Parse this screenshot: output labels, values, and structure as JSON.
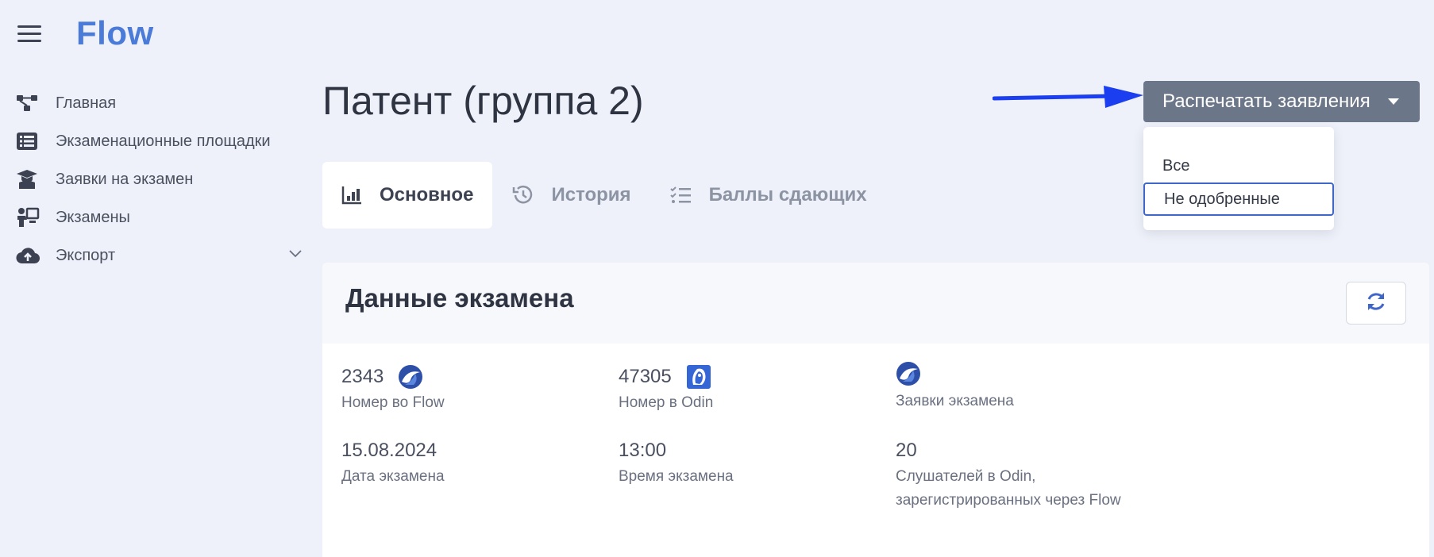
{
  "app": {
    "logo": "Flow"
  },
  "sidebar": {
    "items": [
      {
        "label": "Главная",
        "icon": "network-icon"
      },
      {
        "label": "Экзаменационные площадки",
        "icon": "list-icon"
      },
      {
        "label": "Заявки на экзамен",
        "icon": "graduate-icon"
      },
      {
        "label": "Экзамены",
        "icon": "teacher-icon"
      },
      {
        "label": "Экспорт",
        "icon": "cloud-upload-icon"
      }
    ]
  },
  "page": {
    "title": "Патент (группа 2)"
  },
  "print_button": {
    "label": "Распечатать заявления"
  },
  "dropdown": {
    "items": [
      {
        "label": "Все"
      },
      {
        "label": "Не одобренные"
      }
    ]
  },
  "tabs": [
    {
      "label": "Основное",
      "icon": "chart-icon",
      "active": true
    },
    {
      "label": "История",
      "icon": "history-icon",
      "active": false
    },
    {
      "label": "Баллы сдающих",
      "icon": "checklist-icon",
      "active": false
    }
  ],
  "card": {
    "title": "Данные экзамена",
    "fields": [
      {
        "value": "2343",
        "caption": "Номер во Flow",
        "badge": "flow-logo-icon"
      },
      {
        "value": "47305",
        "caption": "Номер в Odin",
        "badge": "odin-logo-icon"
      },
      {
        "value": "",
        "caption": "Заявки экзамена",
        "badge": "flow-logo-icon"
      },
      {
        "value": "15.08.2024",
        "caption": "Дата экзамена"
      },
      {
        "value": "13:00",
        "caption": "Время экзамена"
      },
      {
        "value": "20",
        "caption": "Слушателей в Odin, зарегистрированных через Flow"
      }
    ]
  },
  "colors": {
    "accent": "#4b7bd8",
    "button": "#6c7689",
    "arrow": "#1a3ef0",
    "focus": "#3f66c9"
  }
}
